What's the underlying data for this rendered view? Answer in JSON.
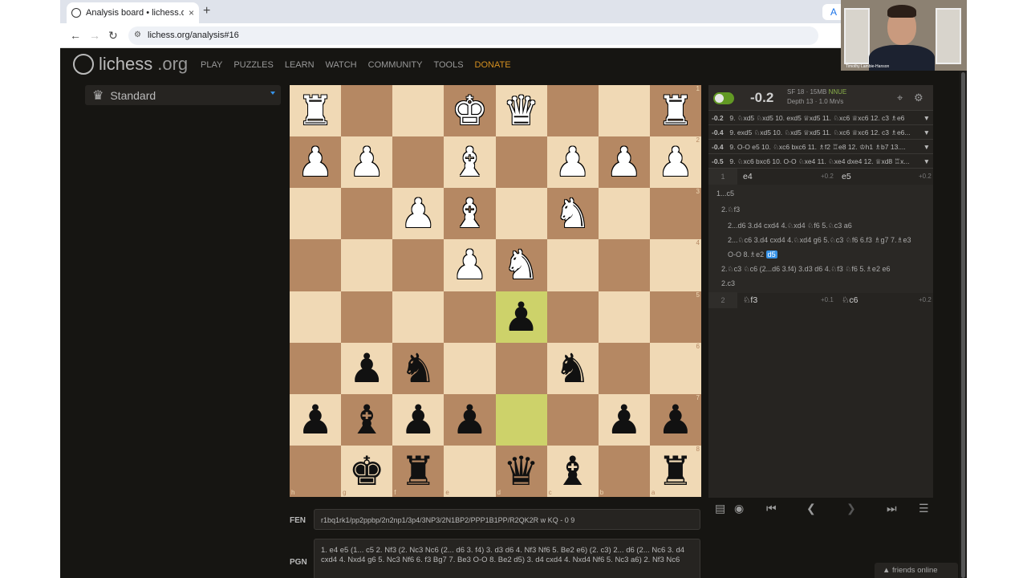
{
  "browser": {
    "tab_title": "Analysis board • lichess.org",
    "tab_close": "×",
    "new_tab": "+",
    "url": "lichess.org/analysis#16",
    "ext_label": "A"
  },
  "site": {
    "logo_text": "lichess",
    "logo_suffix": ".org",
    "nav": [
      "PLAY",
      "PUZZLES",
      "LEARN",
      "WATCH",
      "COMMUNITY",
      "TOOLS",
      "DONATE"
    ]
  },
  "variant": {
    "label": "Standard"
  },
  "board": {
    "orientation": "black",
    "rows": [
      [
        "wR",
        "",
        "",
        "wK",
        "wQ",
        "",
        "",
        "wR"
      ],
      [
        "wP",
        "wP",
        "",
        "wB",
        "",
        "wP",
        "wP",
        "wP"
      ],
      [
        "",
        "",
        "wP",
        "wB",
        "",
        "wN",
        "",
        ""
      ],
      [
        "",
        "",
        "",
        "wP",
        "wN",
        "",
        "",
        ""
      ],
      [
        "",
        "",
        "",
        "",
        "bP",
        "",
        "",
        ""
      ],
      [
        "",
        "bP",
        "bN",
        "",
        "",
        "bN",
        "",
        ""
      ],
      [
        "bP",
        "bB",
        "bP",
        "bP",
        "",
        "",
        "bP",
        "bP"
      ],
      [
        "",
        "bK",
        "bR",
        "",
        "bQ",
        "bB",
        "",
        "bR"
      ]
    ],
    "highlight": [
      "4-4",
      "6-4"
    ],
    "rank_labels": [
      "1",
      "2",
      "3",
      "4",
      "5",
      "6",
      "7",
      "8"
    ],
    "file_labels": [
      "h",
      "g",
      "f",
      "e",
      "d",
      "c",
      "b",
      "a"
    ]
  },
  "fen": {
    "label": "FEN",
    "value": "r1bq1rk1/pp2ppbp/2n2np1/3p4/3NP3/2N1BP2/PPP1B1PP/R2QK2R w KQ - 0 9"
  },
  "pgn": {
    "label": "PGN",
    "value": "1. e4 e5 (1... c5 2. Nf3 (2. Nc3 Nc6 (2... d6 3. f4) 3. d3 d6 4. Nf3 Nf6 5. Be2 e6) (2. c3) 2... d6 (2... Nc6 3. d4 cxd4 4. Nxd4 g6 5. Nc3 Nf6 6. f3 Bg7 7. Be3 O-O 8. Be2 d5) 3. d4 cxd4 4. Nxd4 Nf6 5. Nc3 a6) 2. Nf3 Nc6"
  },
  "ceval": {
    "eval": "-0.2",
    "engine": "SF 18 · 15MB",
    "nnue": "NNUE",
    "depth": "Depth 13 · 1.0 Mn/s",
    "target_icon": "⌖",
    "gear_icon": "⚙",
    "lines": [
      {
        "ev": "-0.2",
        "moves": "9. ♘xd5 ♘xd5 10. exd5 ♕xd5 11. ♘xc6 ♕xc6 12. c3 ♗e6"
      },
      {
        "ev": "-0.4",
        "moves": "9. exd5 ♘xd5 10. ♘xd5 ♕xd5 11. ♘xc6 ♕xc6 12. c3 ♗e6..."
      },
      {
        "ev": "-0.4",
        "moves": "9. O-O e5 10. ♘xc6 bxc6 11. ♗f2 ♖e8 12. ♔h1 ♗b7 13...."
      },
      {
        "ev": "-0.5",
        "moves": "9. ♘xc6 bxc6 10. O-O ♘xe4 11. ♘xe4 dxe4 12. ♕xd8 ♖x..."
      }
    ]
  },
  "moves": {
    "row1": {
      "idx": "1",
      "w": "e4",
      "we": "+0.2",
      "b": "e5",
      "be": "+0.2"
    },
    "row2": {
      "idx": "2",
      "w": "♘f3",
      "we": "+0.1",
      "b": "♘c6",
      "be": "+0.2"
    },
    "var1": "1...c5",
    "var2": "2.♘f3",
    "var3a": "2...d6  3.d4  cxd4  4.♘xd4  ♘f6  5.♘c3  a6",
    "var3b": "2...♘c6  3.d4  cxd4  4.♘xd4  g6  5.♘c3  ♘f6  6.f3  ♗g7  7.♗e3",
    "var3c": "O-O  8.♗e2",
    "var3c_cur": "d5",
    "var4": "2.♘c3  ♘c6  (2...d6 3.f4)  3.d3  d6  4.♘f3  ♘f6  5.♗e2  e6",
    "var5": "2.c3"
  },
  "controls": {
    "first": "⏮",
    "prev": "❮",
    "next": "❯",
    "last": "⏭",
    "menu": "☰",
    "book": "▤",
    "explorer": "◉"
  },
  "friends": "▲ friends online",
  "webcam": {
    "name": "Timothy Lambie-Hanson"
  }
}
